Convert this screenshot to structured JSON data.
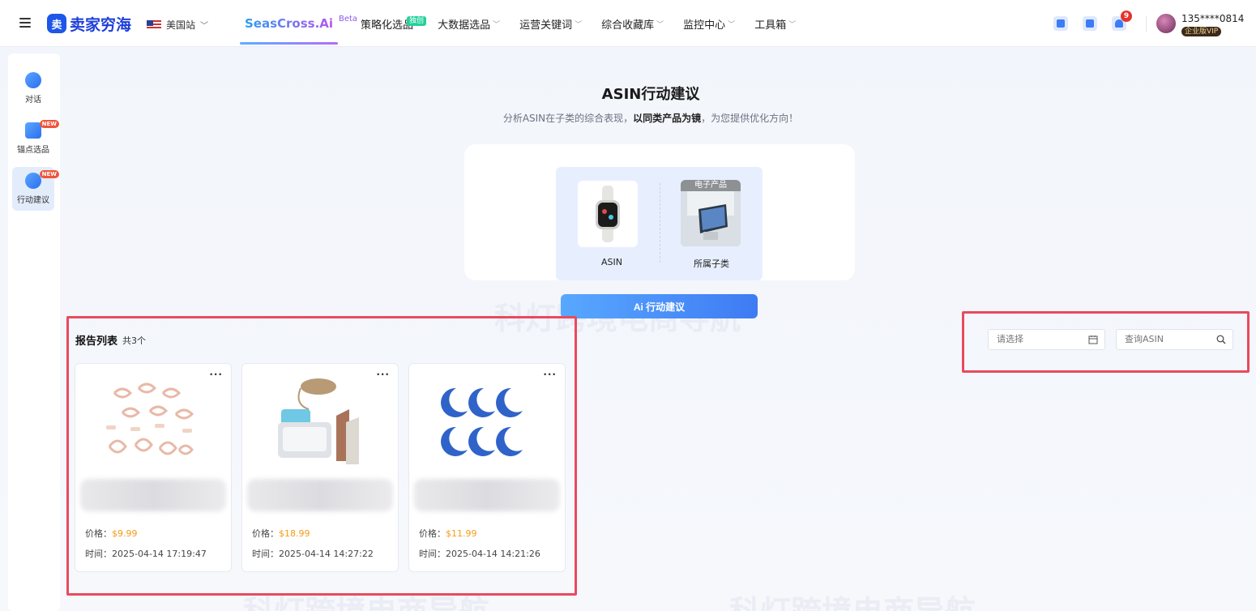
{
  "header": {
    "logo_text": "卖家穷海",
    "region": "美国站",
    "nav": [
      {
        "label": "SeasCross.Ai",
        "badge": "Beta"
      },
      {
        "label": "策略化选品",
        "badge": "独创"
      },
      {
        "label": "大数据选品"
      },
      {
        "label": "运营关键词"
      },
      {
        "label": "综合收藏库"
      },
      {
        "label": "监控中心"
      },
      {
        "label": "工具箱"
      }
    ],
    "notification_count": "9",
    "user_phone": "135****0814",
    "user_level": "企业版VIP"
  },
  "sidebar": {
    "items": [
      {
        "label": "对话",
        "icon": "chat-bot-icon"
      },
      {
        "label": "锚点选品",
        "icon": "cube-plus-icon",
        "badge": "NEW"
      },
      {
        "label": "行动建议",
        "icon": "compass-icon",
        "badge": "NEW"
      }
    ]
  },
  "main": {
    "title": "ASIN行动建议",
    "subtitle_pre": "分析ASIN在子类的综合表现，",
    "subtitle_bold": "以同类产品为镜",
    "subtitle_post": "，为您提供优化方向！",
    "compare": {
      "asin_label": "ASIN",
      "subcategory_label": "所属子类",
      "subcategory_tag": "电子产品"
    },
    "ai_button": "Ai 行动建议"
  },
  "report_list": {
    "title": "报告列表",
    "count": "共3个",
    "price_label": "价格：",
    "time_label": "时间：",
    "items": [
      {
        "price": "$9.99",
        "time": "2025-04-14 17:19:47"
      },
      {
        "price": "$18.99",
        "time": "2025-04-14 14:27:22"
      },
      {
        "price": "$11.99",
        "time": "2025-04-14 14:21:26"
      }
    ]
  },
  "filters": {
    "date_placeholder": "请选择",
    "search_placeholder": "查询ASIN"
  },
  "watermark": "科灯跨境电商导航",
  "colors": {
    "accent": "#3e7bf3",
    "price": "#f39c12",
    "highlight": "#e94a5e"
  }
}
